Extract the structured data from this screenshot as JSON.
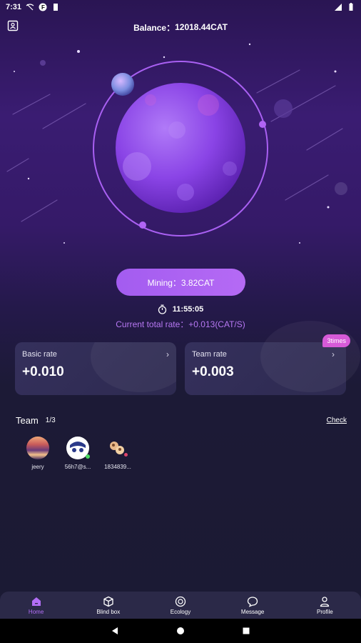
{
  "status_bar": {
    "time": "7:31"
  },
  "header": {
    "balance_label": "Balance：",
    "balance_value": "12018.44CAT"
  },
  "mining": {
    "button_label": "Mining：3.82CAT",
    "timer": "11:55:05",
    "current_rate": "Current total rate：+0.013(CAT/S)"
  },
  "cards": {
    "basic": {
      "title": "Basic rate",
      "value": "+0.010"
    },
    "team": {
      "title": "Team rate",
      "value": "+0.003",
      "badge": "3times"
    }
  },
  "team": {
    "label": "Team",
    "count": "1/3",
    "check_label": "Check",
    "members": [
      {
        "name": "jeery"
      },
      {
        "name": "56h7@s..."
      },
      {
        "name": "1834839..."
      }
    ]
  },
  "nav": {
    "items": [
      {
        "label": "Home",
        "icon": "home-icon"
      },
      {
        "label": "Blind box",
        "icon": "box-icon"
      },
      {
        "label": "Ecology",
        "icon": "ecology-icon"
      },
      {
        "label": "Message",
        "icon": "message-icon"
      },
      {
        "label": "Profile",
        "icon": "profile-icon"
      }
    ]
  },
  "colors": {
    "accent": "#a35cf0",
    "background": "#1b1a33",
    "badge": "#d65ad8"
  }
}
